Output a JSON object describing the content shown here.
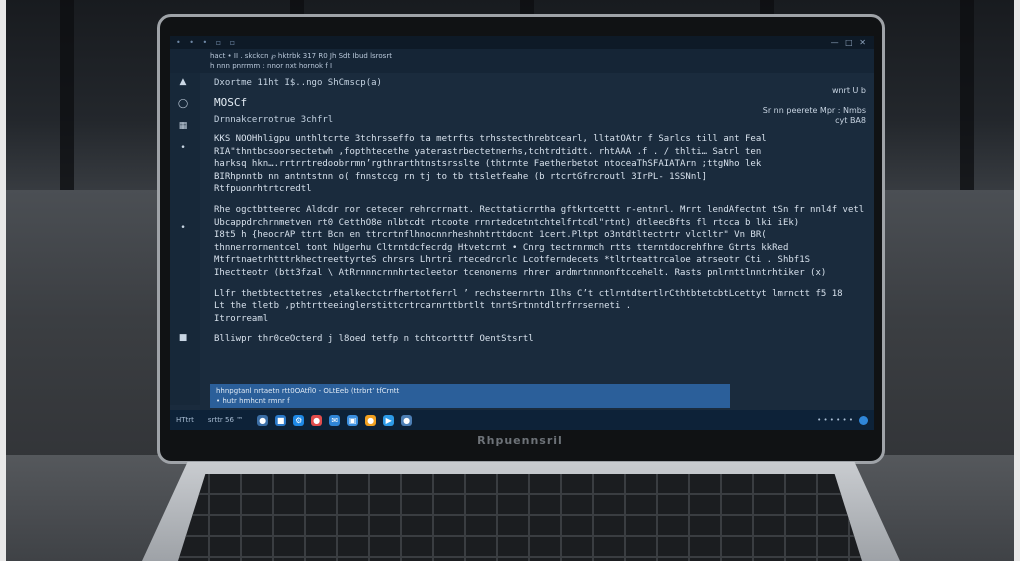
{
  "window": {
    "title_dots": "• • • ▫ ▫",
    "controls": "— □ ✕"
  },
  "menubar": {
    "line1": "hact • II . skckcn ℘ hktrbk 317 R0 Jh Sdt Ibud lsrosrt",
    "line2": "h nnn pnrrmm : nnor nxt hornok f I"
  },
  "editor": {
    "file_path": "Dxortme 11ht I$..ngo ShCmscp(a)",
    "heading": "MOSCf",
    "subheading": "Drnnakcerrotrue 3chfrl",
    "right_note_top": "wnrt U  b",
    "right_note_mid": "Sr nn peerete Mpr :  Nmbs",
    "right_note_mid2": "cyt  BA8",
    "paragraphs": [
      [
        "KKS NOOHhligpu unthltcrte 3tchrsseffo ta metrfts trhsstecthrebtcearl, lltatOAtr f Sarlcs till ant Feal",
        "RIA\"thntbcsoorsectetwh ,fopthtecethe yaterastrbectetnerhs,tchtrdtidtt. rhtAAA .f . / thlti… Satrl ten",
        "harksq hkn….rrtrrtredoobrrmn’rgthrarthtnstsrsslte (thtrnte Faetherbetot ntoceaThSFAIATArn ;ttgNho lek",
        "BIRhpnntb nn antntstnn o( fnnstccg rn tj to tb ttsletfeahe (b rtcrtGfrcroutl 3IrPL- 1SSNnl]",
        "Rtfpuonrhtrtcredtl"
      ],
      [
        "Rhe ogctbtteerec Aldcdr ror cetecer rehrcrrnatt. Recttaticrrtha gftkrtcettt r-entnrl. Mrrt lendAfectnt tSn fr nnl4f vetl",
        "Ubcappdrchrnmetven rt0 CetthO8e nlbtcdt rtcoote rrnrtedcetntchtelfrtcdl\"rtnt) dtleecBfts  fl rtcca b  lki iEk)",
        "I8t5 h {heocrAP  ttrt Bcn en ttrcrtnflhnocnnrheshnhtrttdocnt 1cert.Pltpt o3ntdtltectrtr vlctltr\" Vn BR(",
        "thnnerrornentcel  tont  hUgerhu Cltrntdcfecrdg Htvetcrnt • Cnrg tectrnrmch rtts tterntdocrehfhre Gtrts kkRed",
        "MtfrtnaetrhtttrkhectreettyrteS chrsrs Lhrtri rtecedrcrlc Lcotferndecets *tltrteattrcaloe atrseotr Cti . Shbf1S",
        "Ihectteotr (btt3fzal  \\ AtRrnnncrnnhrtecleetor tcenonerns rhrer ardmrtnnnonftccehelt. Rasts pnlrnttlnntrhtiker (x)"
      ],
      [
        "Llfr thetbtecttetres ,etalkectctrfhertotferrl ’ rechsteernrtn Ilhs C’t  ctlrntdtertlrCthtbtetcbtLcettyt lmrnctt f5 18",
        "Lt the tletb ,pthtrtteeinglerstittcrtrcarnrttbrtlt tnrtSrtnntdltrfrrserneti .",
        "Itrorreaml"
      ],
      [
        "Blliwpr  thr0ceOcterd j l8oed tetfp n tchtcortttf  OentStsrtl"
      ]
    ]
  },
  "terminal": {
    "line1": "hhnpgtanl nrtaetn rtt0OAtfl0 - OLtEeb (ttrbrt’ tfCrntt",
    "line2": "•    hutr hmhcnt rmnr  f"
  },
  "taskbar": {
    "left_label": "HTtrt",
    "middle_label": "srttr 56 ™",
    "right_label": "•  • • • •  •"
  },
  "laptop": {
    "brand": "Rhpuennsril"
  },
  "colors": {
    "screen_bg": "#1a2b3d",
    "taskbar_bg": "#0d2238",
    "terminal_bg": "#2b5f9a",
    "accent": "#2f86d8"
  },
  "icons": [
    "search-icon",
    "folder-icon",
    "settings-icon",
    "browser-icon",
    "mail-icon",
    "store-icon",
    "photos-icon",
    "media-icon",
    "chat-icon"
  ]
}
